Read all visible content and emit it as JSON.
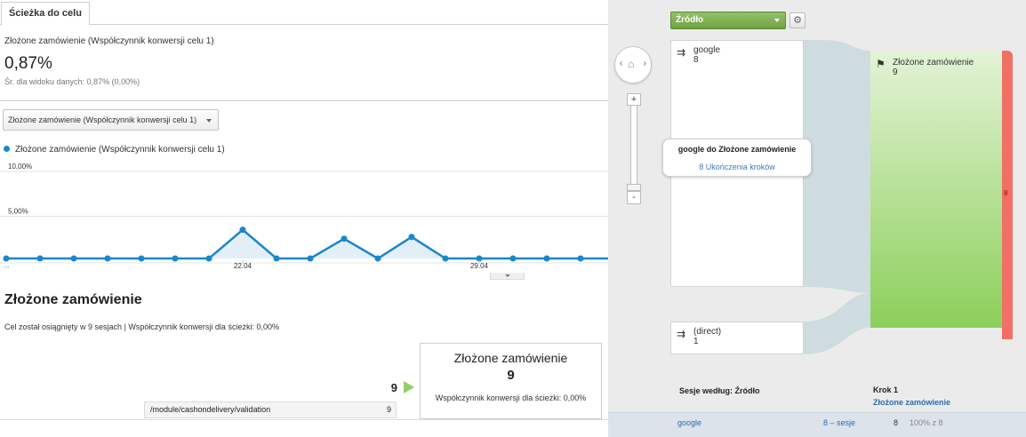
{
  "tab": {
    "label": "Ścieżka do celu"
  },
  "metric": {
    "label": "Złożone zamówienie (Współczynnik konwersji celu 1)",
    "value": "0,87%",
    "average": "Śr. dla widoku danych: 0,87% (0,00%)"
  },
  "metric_dropdown": {
    "selected": "Złożone zamówienie (Współczynnik konwersji celu 1)"
  },
  "chart_legend": "Złożone zamówienie (Współczynnik konwersji celu 1)",
  "chart_data": {
    "type": "area",
    "series": [
      {
        "name": "Złożone zamówienie (Współczynnik konwersji celu 1)",
        "values": [
          0,
          0,
          0,
          0,
          0,
          0,
          0,
          3.2,
          0,
          0,
          2.2,
          0,
          2.4,
          0,
          0,
          0,
          0,
          0
        ]
      }
    ],
    "ylim": [
      0,
      10
    ],
    "y_ticks": [
      "10,00%",
      "5,00%"
    ],
    "x_tick_labels": [
      {
        "index": 7,
        "label": "22.04"
      },
      {
        "index": 14,
        "label": "29.04"
      }
    ],
    "x_start_label": "...",
    "grid": true,
    "color": "#1a87c9",
    "fill_color": "#e3eef7"
  },
  "goal": {
    "title": "Złożone zamówienie",
    "description": "Cel został osiągnięty w 9 sesjach | Współczynnik konwersji dla ścieżki: 0,00%",
    "funnel_count": "9",
    "box_name": "Złożone zamówienie",
    "box_count": "9",
    "box_rate": "Współczynnik konwersji dla ścieżki: 0,00%",
    "page_path": "/module/cashondelivery/validation",
    "page_count": "9"
  },
  "flow": {
    "dimension_select": "Źródło",
    "gear_icon": "gear-icon",
    "nodes": {
      "google": {
        "name": "google",
        "count": "8"
      },
      "direct": {
        "name": "(direct)",
        "count": "1"
      },
      "goal": {
        "name": "Złożone zamówienie",
        "count": "9"
      }
    },
    "exit_count": "8",
    "tooltip": {
      "title": "google do Złożone zamówienie",
      "link": "8 Ukończenia kroków"
    },
    "col_sessions": "Sesje według: Źródło",
    "col_step": "Krok 1",
    "col_step_goal": "Złożone zamówienie",
    "bottom": {
      "source": "google",
      "sessions": "8 – sesje",
      "count": "8",
      "pct": "100% z 8"
    },
    "colors": {
      "goal_green": "#8ccf5a",
      "exit_red": "#f07066",
      "flow_band": "#cfdcdf"
    }
  }
}
